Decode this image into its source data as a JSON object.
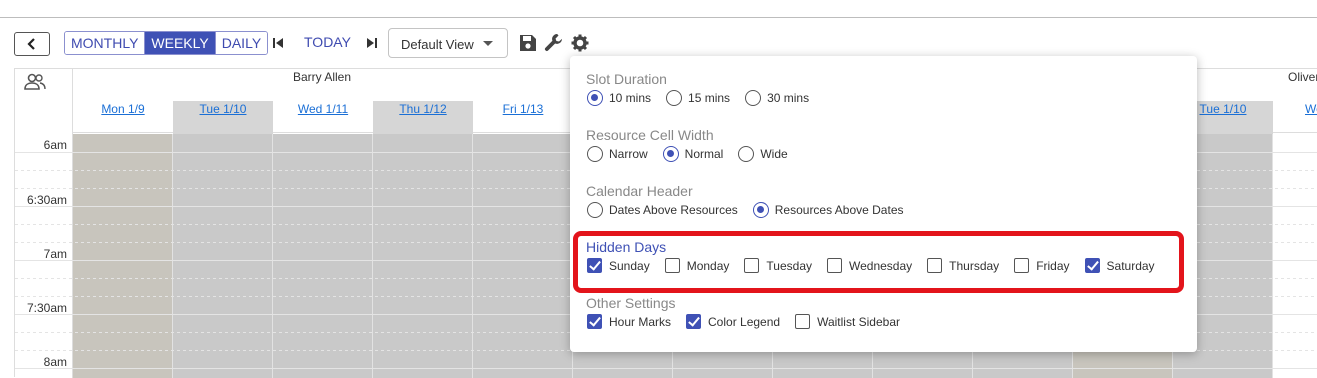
{
  "toolbar": {
    "views": [
      "MONTHLY",
      "WEEKLY",
      "DAILY"
    ],
    "active_view": "WEEKLY",
    "today_label": "TODAY",
    "view_select": "Default View"
  },
  "calendar": {
    "resources": [
      "Barry Allen",
      "Oliver"
    ],
    "days_res1": [
      {
        "label": "Mon 1/9",
        "shaded": false
      },
      {
        "label": "Tue 1/10",
        "shaded": true
      },
      {
        "label": "Wed 1/11",
        "shaded": false
      },
      {
        "label": "Thu 1/12",
        "shaded": true
      },
      {
        "label": "Fri 1/13",
        "shaded": false
      }
    ],
    "days_res2": [
      {
        "label": "Tue 1/10",
        "shaded": true
      },
      {
        "label": "Wed",
        "shaded": false
      }
    ],
    "times": [
      "6am",
      "6:30am",
      "7am",
      "7:30am",
      "8am"
    ]
  },
  "settings": {
    "slot_duration": {
      "title": "Slot Duration",
      "options": [
        {
          "label": "10 mins",
          "checked": true
        },
        {
          "label": "15 mins",
          "checked": false
        },
        {
          "label": "30 mins",
          "checked": false
        }
      ]
    },
    "cell_width": {
      "title": "Resource Cell Width",
      "options": [
        {
          "label": "Narrow",
          "checked": false
        },
        {
          "label": "Normal",
          "checked": true
        },
        {
          "label": "Wide",
          "checked": false
        }
      ]
    },
    "calendar_header": {
      "title": "Calendar Header",
      "options": [
        {
          "label": "Dates Above Resources",
          "checked": false
        },
        {
          "label": "Resources Above Dates",
          "checked": true
        }
      ]
    },
    "hidden_days": {
      "title": "Hidden Days",
      "options": [
        {
          "label": "Sunday",
          "checked": true
        },
        {
          "label": "Monday",
          "checked": false
        },
        {
          "label": "Tuesday",
          "checked": false
        },
        {
          "label": "Wednesday",
          "checked": false
        },
        {
          "label": "Thursday",
          "checked": false
        },
        {
          "label": "Friday",
          "checked": false
        },
        {
          "label": "Saturday",
          "checked": true
        }
      ]
    },
    "other_settings": {
      "title": "Other Settings",
      "options": [
        {
          "label": "Hour Marks",
          "checked": true
        },
        {
          "label": "Color Legend",
          "checked": true
        },
        {
          "label": "Waitlist Sidebar",
          "checked": false
        }
      ]
    }
  },
  "colors": {
    "accent": "#3f51b5",
    "highlight": "#e3141b",
    "link": "#1a6fd6"
  }
}
